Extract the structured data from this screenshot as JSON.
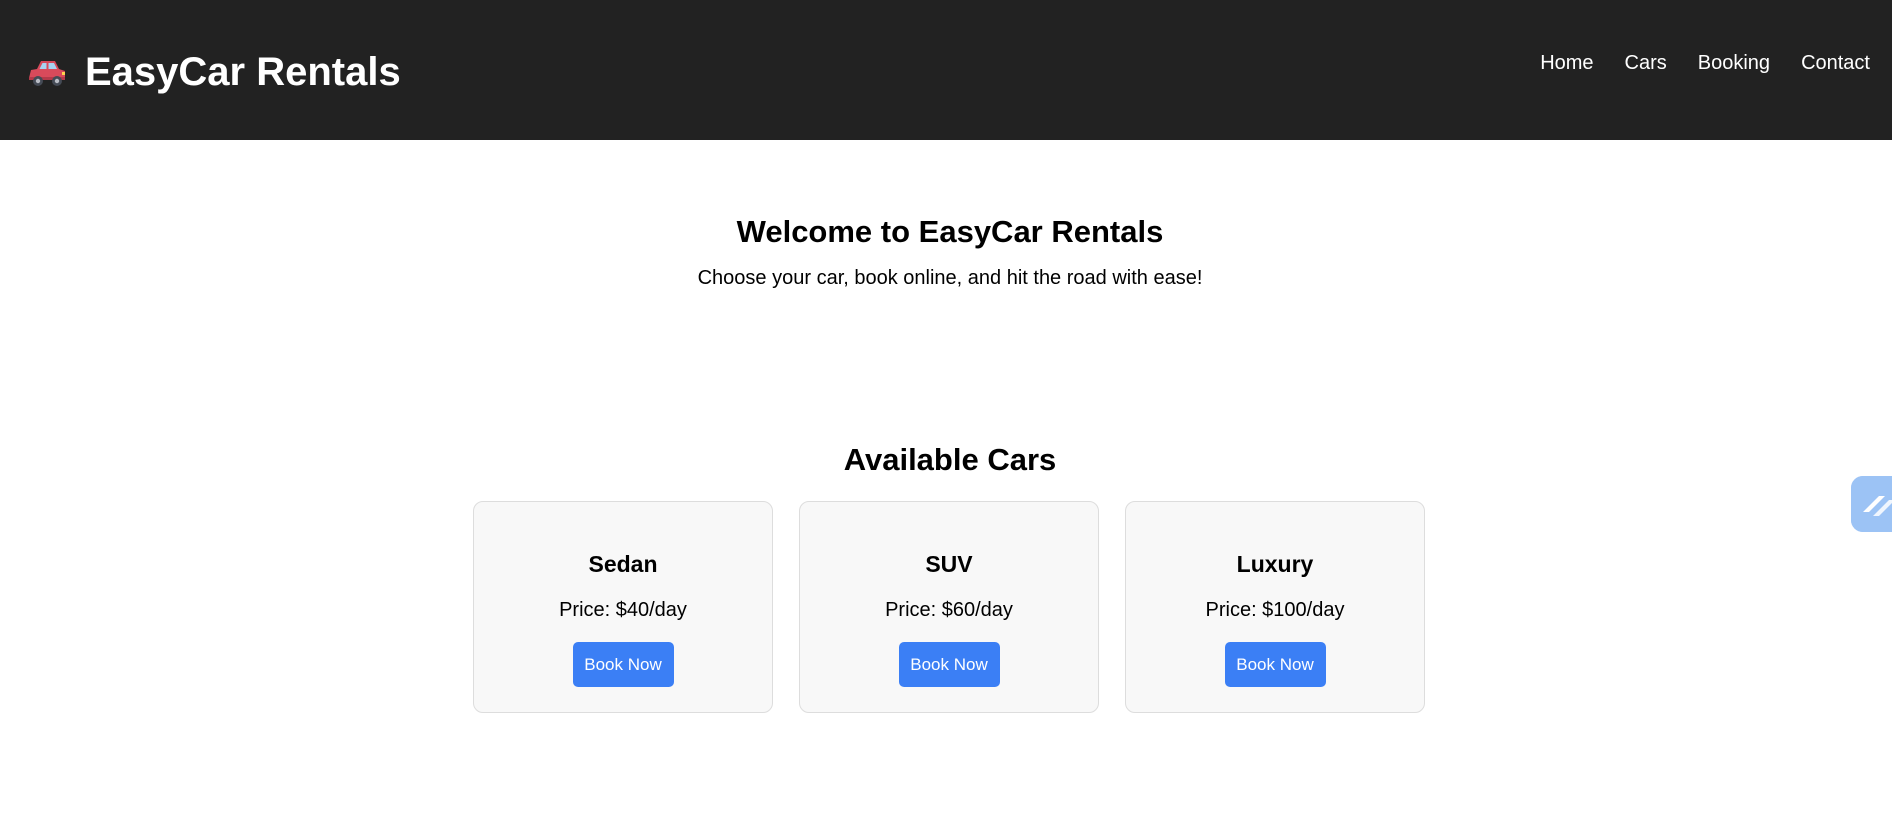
{
  "header": {
    "brand_icon": "car-icon",
    "title": "EasyCar Rentals",
    "nav": [
      {
        "label": "Home"
      },
      {
        "label": "Cars"
      },
      {
        "label": "Booking"
      },
      {
        "label": "Contact"
      }
    ]
  },
  "hero": {
    "title": "Welcome to EasyCar Rentals",
    "subtitle": "Choose your car, book online, and hit the road with ease!"
  },
  "cars_section": {
    "heading": "Available Cars",
    "cards": [
      {
        "name": "Sedan",
        "price": "Price: $40/day",
        "button": "Book Now"
      },
      {
        "name": "SUV",
        "price": "Price: $60/day",
        "button": "Book Now"
      },
      {
        "name": "Luxury",
        "price": "Price: $100/day",
        "button": "Book Now"
      }
    ]
  },
  "side_widget": {
    "icon": "link-icon"
  },
  "colors": {
    "header_bg": "#222222",
    "accent": "#3b7ff5",
    "card_bg": "#f8f8f8"
  }
}
